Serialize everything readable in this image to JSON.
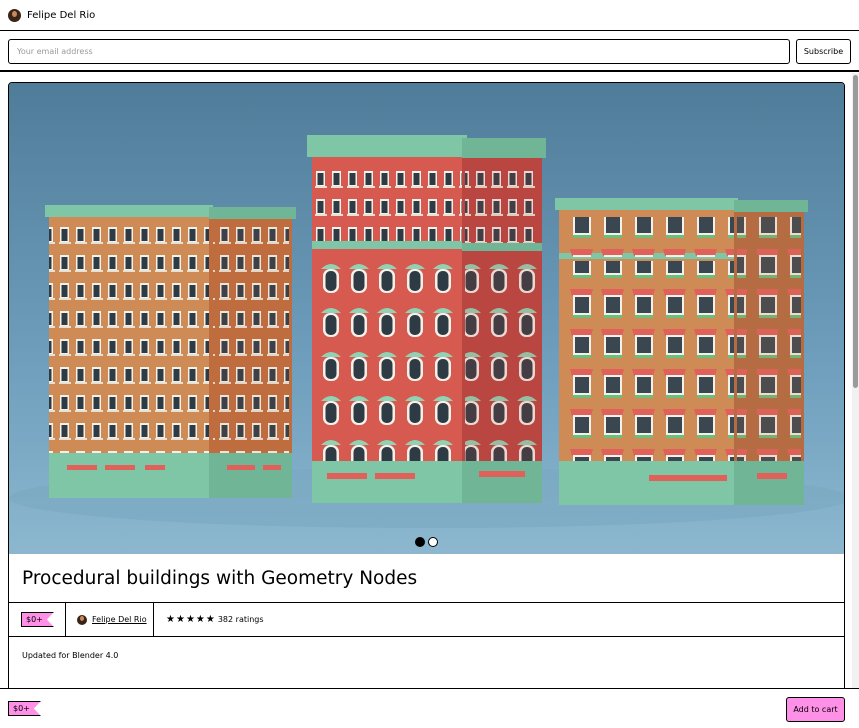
{
  "header": {
    "creator_name": "Felipe Del Rio",
    "avatar_icon": "creator-avatar"
  },
  "subscribe": {
    "email_placeholder": "Your email address",
    "email_value": "",
    "button_label": "Subscribe"
  },
  "product": {
    "title": "Procedural buildings with Geometry Nodes",
    "price": "$0+",
    "author": "Felipe Del Rio",
    "rating_stars": 5,
    "ratings_text": "382 ratings",
    "description": "Updated for Blender 4.0",
    "carousel": {
      "total_slides": 2,
      "active_slide": 1
    }
  },
  "footer": {
    "price": "$0+",
    "add_to_cart_label": "Add to cart"
  },
  "colors": {
    "accent_pink": "#ff90e8",
    "sky": "#6f9fbd",
    "brick_orange": "#cf8b55",
    "brick_red": "#d65a50",
    "trim_green": "#7ec6a6"
  }
}
